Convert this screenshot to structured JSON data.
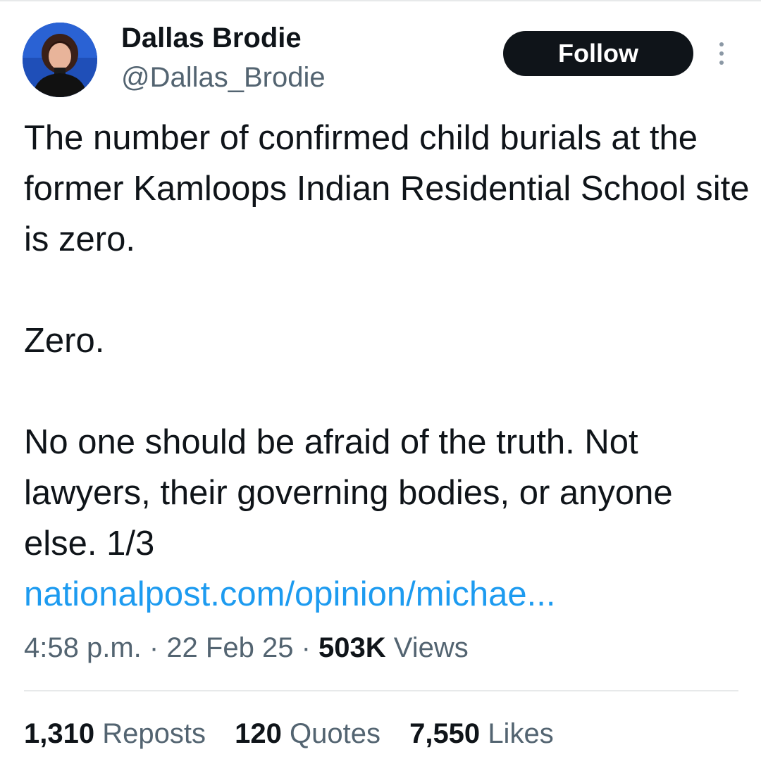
{
  "author": {
    "display_name": "Dallas Brodie",
    "handle": "@Dallas_Brodie",
    "avatar": "profile-photo"
  },
  "actions": {
    "follow_label": "Follow",
    "more_icon": "more-vertical-icon"
  },
  "tweet": {
    "paragraphs": [
      "The number of confirmed child burials at the former Kamloops Indian Residential School site is zero.",
      "Zero.",
      "No one should be afraid of the truth. Not lawyers, their governing bodies, or anyone else. 1/3"
    ],
    "link": "nationalpost.com/opinion/michae..."
  },
  "meta": {
    "time": "4:58 p.m.",
    "separator": " · ",
    "date": "22 Feb 25",
    "views_count": "503K",
    "views_label": "Views"
  },
  "stats": [
    {
      "count": "1,310",
      "label": "Reposts"
    },
    {
      "count": "120",
      "label": "Quotes"
    },
    {
      "count": "7,550",
      "label": "Likes"
    }
  ],
  "colors": {
    "link": "#1d9bf0",
    "secondary_text": "#536471",
    "primary_text": "#0f1419",
    "button_bg": "#0f1419",
    "avatar_bg": "#1f4fb8"
  }
}
